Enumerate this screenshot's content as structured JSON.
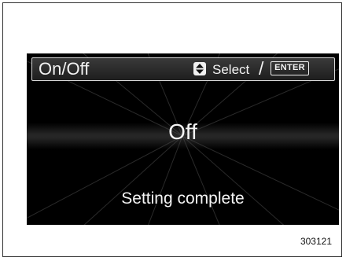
{
  "header": {
    "title": "On/Off",
    "select_label": "Select",
    "separator": "/",
    "enter_label": "ENTER",
    "updown_icon": "up-down-arrows-icon"
  },
  "main": {
    "value": "Off",
    "status": "Setting complete"
  },
  "figure_code": "303121",
  "colors": {
    "screen_background": "#000000",
    "text": "#f2f2f2",
    "header_border": "#d8d8d8"
  }
}
